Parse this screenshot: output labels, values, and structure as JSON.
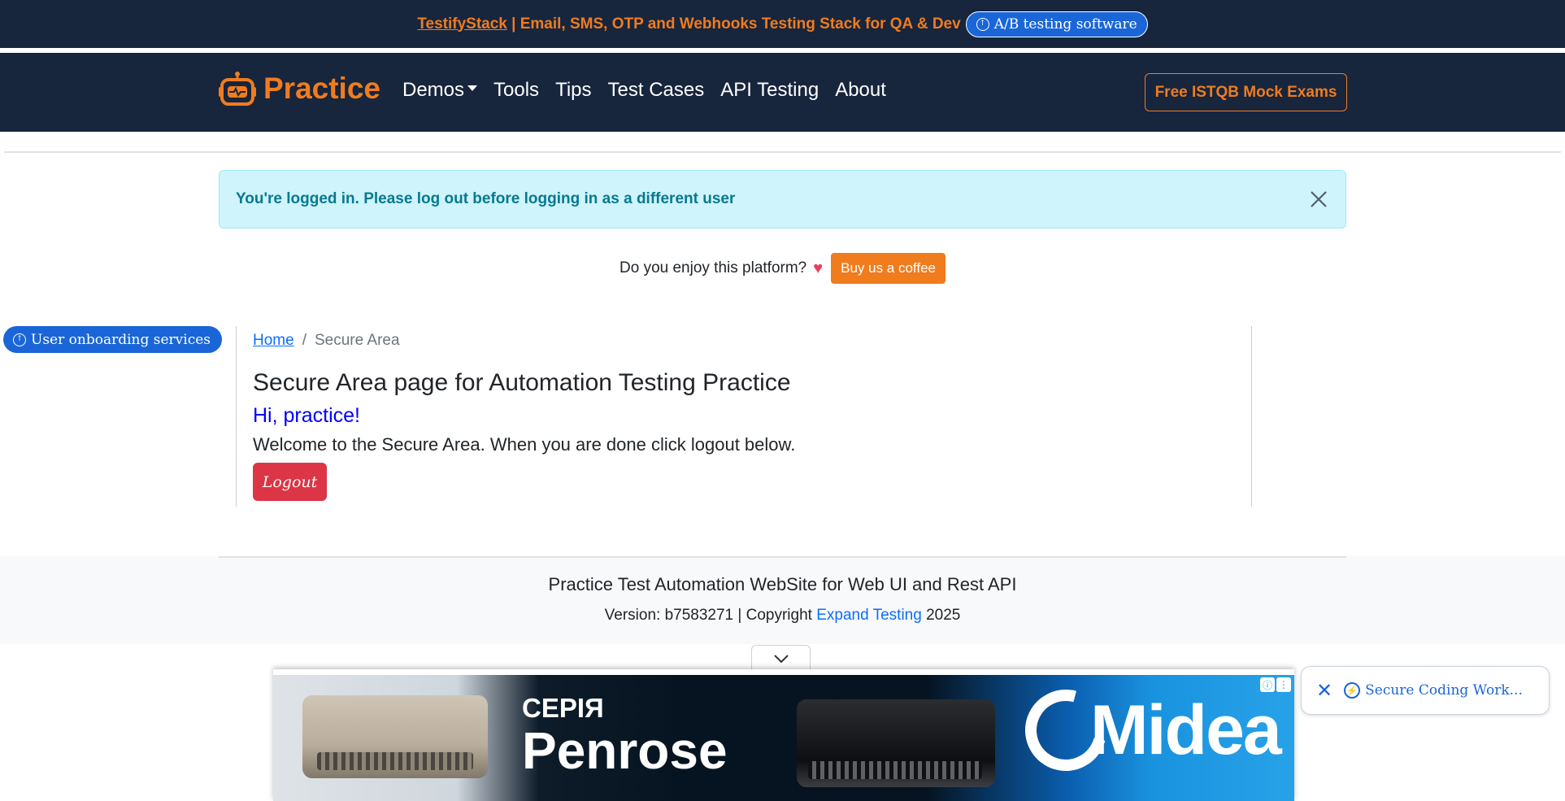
{
  "promo": {
    "brand_link": "TestifyStack",
    "text": " | Email, SMS, OTP and Webhooks Testing Stack for QA & Dev",
    "ab_pill": "A/B testing software"
  },
  "navbar": {
    "brand": "Practice",
    "items": [
      "Demos",
      "Tools",
      "Tips",
      "Test Cases",
      "API Testing",
      "About"
    ],
    "cta": "Free ISTQB Mock Exams"
  },
  "alert": {
    "message": "You're logged in. Please log out before logging in as a different user"
  },
  "support": {
    "question": "Do you enjoy this platform?",
    "button": "Buy us a coffee"
  },
  "side_pill": "User onboarding services",
  "breadcrumb": {
    "home": "Home",
    "separator": "/",
    "current": "Secure Area"
  },
  "main": {
    "title": "Secure Area page for Automation Testing Practice",
    "greeting": "Hi, practice!",
    "welcome": "Welcome to the Secure Area. When you are done click logout below.",
    "logout": "Logout"
  },
  "footer": {
    "title": "Practice Test Automation WebSite for Web UI and Rest API",
    "version_prefix": "Version: b7583271 | Copyright ",
    "company_link": "Expand Testing",
    "year": " 2025"
  },
  "ad": {
    "series": "СЕРІЯ",
    "model": "Penrose",
    "brand": "Midea"
  },
  "chip": {
    "text": "Secure Coding Work..."
  },
  "colors": {
    "navy": "#17253d",
    "orange": "#f07c1e",
    "alert_bg": "#cff4fc",
    "danger": "#dc3545",
    "link": "#0d6efd"
  }
}
